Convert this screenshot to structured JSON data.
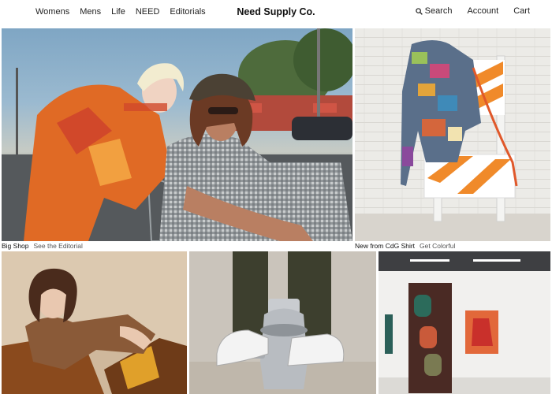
{
  "header": {
    "nav_left": [
      "Womens",
      "Mens",
      "Life",
      "NEED",
      "Editorials"
    ],
    "logo": "Need Supply Co.",
    "search_label": "Search",
    "account_label": "Account",
    "cart_label": "Cart"
  },
  "tiles": [
    {
      "title": "Big Shop",
      "link": "See the Editorial"
    },
    {
      "title": "New from CdG Shirt",
      "link": "Get Colorful"
    }
  ]
}
